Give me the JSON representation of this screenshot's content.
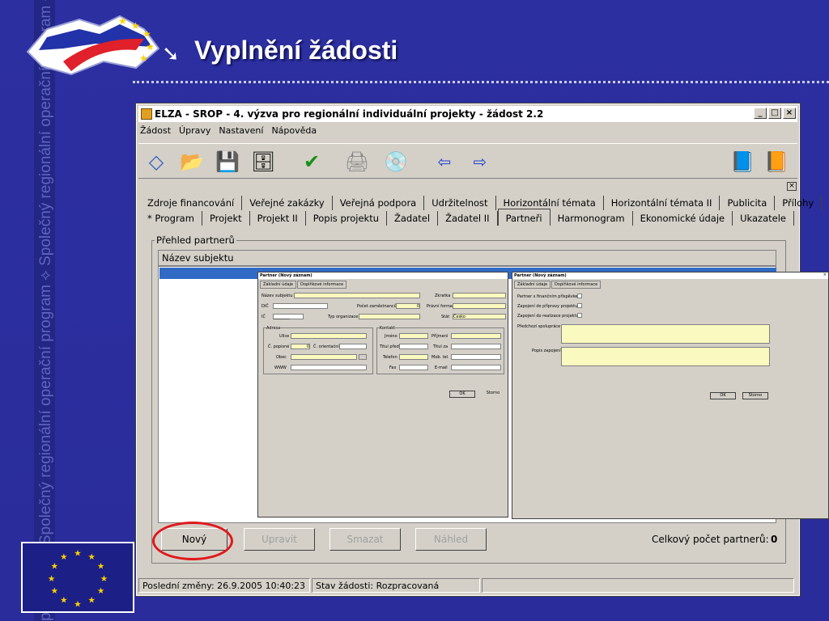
{
  "slide": {
    "title": "Vyplnění žádosti",
    "arrow": "➘",
    "vertical_text": "program ⟡ Společný regionální operační program ⟡ Společný regionální operační program ⟡ Společný regionální operační program ⟡ Společný regionální operační program"
  },
  "colors": {
    "background": "#2a2c9b",
    "title": "#ffffff",
    "window": "#d4d0c8",
    "selection": "#316ac5",
    "highlight": "#e0181c",
    "required_field": "#fafac0"
  },
  "window": {
    "title": "ELZA - SROP - 4. výzva pro regionální individuální projekty - žádost 2.2",
    "min": "_",
    "max": "□",
    "close": "×"
  },
  "menu": [
    "Žádost",
    "Úpravy",
    "Nastavení",
    "Nápověda"
  ],
  "toolbar_icons": [
    "new-icon",
    "open-icon",
    "save-icon",
    "submit-icon",
    "check-icon",
    "print-icon",
    "disk-icon",
    "back-arrow-icon",
    "forward-arrow-icon",
    "help-book-icon",
    "info-book-icon"
  ],
  "toolbar_glyphs": {
    "new": "◇",
    "open": "📂",
    "save": "💾",
    "submit": "🗄",
    "check": "✔",
    "print": "🖨",
    "disk": "💿",
    "back": "⇦",
    "forward": "⇨",
    "help": "📘",
    "info": "📙"
  },
  "tabs_row1": [
    "Zdroje financování",
    "Veřejné zakázky",
    "Veřejná podpora",
    "Udržitelnost",
    "Horizontální témata",
    "Horizontální témata II",
    "Publicita",
    "Přílohy"
  ],
  "tabs_row2": [
    "* Program",
    "Projekt",
    "Projekt II",
    "Popis projektu",
    "Žadatel",
    "Žadatel II",
    "Partneři",
    "Harmonogram",
    "Ekonomické údaje",
    "Ukazatele"
  ],
  "group_label": "Přehled partnerů",
  "list_header": "Název subjektu",
  "buttons": {
    "new": "Nový",
    "edit": "Upravit",
    "delete": "Smazat",
    "preview": "Náhled"
  },
  "count_label": "Celkový počet partnerů:",
  "count_value": "0",
  "status": {
    "last_change": "Poslední změny: 26.9.2005 10:40:23",
    "state": "Stav žádosti: Rozpracovaná"
  },
  "dialog1": {
    "title": "Partner (Nový záznam)",
    "tabs": [
      "Základní údaje",
      "Doplňkové informace"
    ],
    "name": "Název subjektu",
    "dic": "DIČ",
    "ic": "IČ",
    "ic_value": "________",
    "zkratka": "Zkratka",
    "pocet": "Počet zaměstnanců",
    "pocet_value": "0",
    "forma": "Právní forma",
    "typ": "Typ organizace",
    "stat": "Stát",
    "stat_value": "Česko",
    "adresa": "Adresa",
    "ulice": "Ulice",
    "cp": "Č. popisné",
    "cp_value": "0",
    "co": "Č. orientační",
    "obec": "Obec",
    "www": "WWW",
    "kontakt": "Kontakt",
    "jmeno": "Jméno",
    "prijmeni": "Příjmení",
    "titul_pred": "Titul před",
    "titul_za": "Titul za",
    "telefon": "Telefon",
    "mob": "Mob. tel.",
    "fax": "Fax",
    "email": "E-mail",
    "ok": "OK",
    "storno": "Storno"
  },
  "dialog2": {
    "title": "Partner (Nový záznam)",
    "tabs": [
      "Základní údaje",
      "Doplňkové informace"
    ],
    "c1": "Partner s finančním příspěvkem",
    "c2": "Zapojení do přípravy projektu",
    "c3": "Zapojení do realizace projektu",
    "predchozi": "Předchozí spolupráce",
    "popis": "Popis zapojení",
    "ok": "OK",
    "storno": "Storno",
    "close": "×"
  }
}
